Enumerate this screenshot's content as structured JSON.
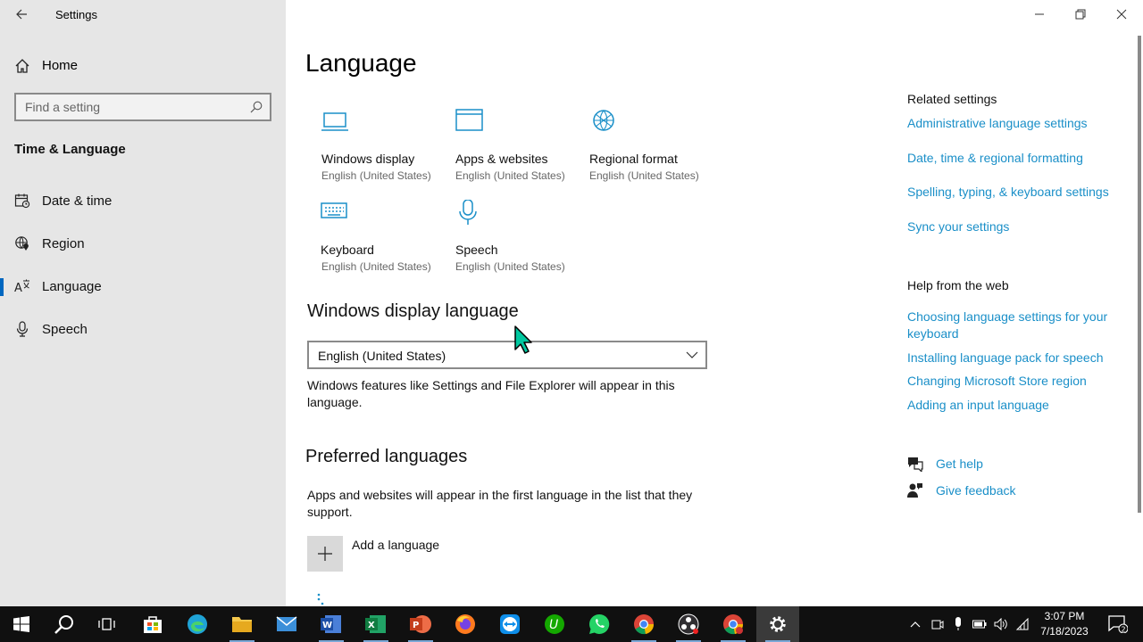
{
  "window": {
    "title": "Settings"
  },
  "sidebar": {
    "home_label": "Home",
    "search_placeholder": "Find a setting",
    "section_title": "Time & Language",
    "items": [
      {
        "label": "Date & time",
        "icon": "calendar-clock-icon"
      },
      {
        "label": "Region",
        "icon": "globe-pin-icon"
      },
      {
        "label": "Language",
        "icon": "language-icon",
        "selected": true
      },
      {
        "label": "Speech",
        "icon": "microphone-icon"
      }
    ]
  },
  "main": {
    "title": "Language",
    "tiles": [
      {
        "title": "Windows display",
        "subtitle": "English (United States)",
        "icon": "laptop-icon"
      },
      {
        "title": "Apps & websites",
        "subtitle": "English (United States)",
        "icon": "browser-window-icon"
      },
      {
        "title": "Regional format",
        "subtitle": "English (United States)",
        "icon": "globe-icon"
      },
      {
        "title": "Keyboard",
        "subtitle": "English (United States)",
        "icon": "keyboard-icon"
      },
      {
        "title": "Speech",
        "subtitle": "English (United States)",
        "icon": "microphone-icon"
      }
    ],
    "display_language": {
      "heading": "Windows display language",
      "selected": "English (United States)",
      "description": "Windows features like Settings and File Explorer will appear in this language."
    },
    "preferred": {
      "heading": "Preferred languages",
      "description": "Apps and websites will appear in the first language in the list that they support.",
      "add_label": "Add a language"
    }
  },
  "related": {
    "heading": "Related settings",
    "links": [
      "Administrative language settings",
      "Date, time & regional formatting",
      "Spelling, typing, & keyboard settings",
      "Sync your settings"
    ]
  },
  "help": {
    "heading": "Help from the web",
    "links": [
      "Choosing language settings for your keyboard",
      "Installing language pack for speech",
      "Changing Microsoft Store region",
      "Adding an input language"
    ],
    "get_help": "Get help",
    "give_feedback": "Give feedback"
  },
  "taskbar": {
    "apps": [
      "start",
      "search",
      "task-view",
      "store",
      "edge",
      "file-explorer",
      "mail",
      "word",
      "excel",
      "powerpoint",
      "firefox",
      "teamviewer",
      "upwork",
      "whatsapp",
      "chrome",
      "obs",
      "chrome-profile",
      "settings"
    ],
    "time": "3:07 PM",
    "date": "7/18/2023",
    "notification_count": "2"
  },
  "colors": {
    "accent": "#0067c0",
    "link": "#1a8fc8",
    "sidebar_bg": "#e6e6e6",
    "cursor": "#00c8a0",
    "taskbar_bg": "#101010"
  }
}
